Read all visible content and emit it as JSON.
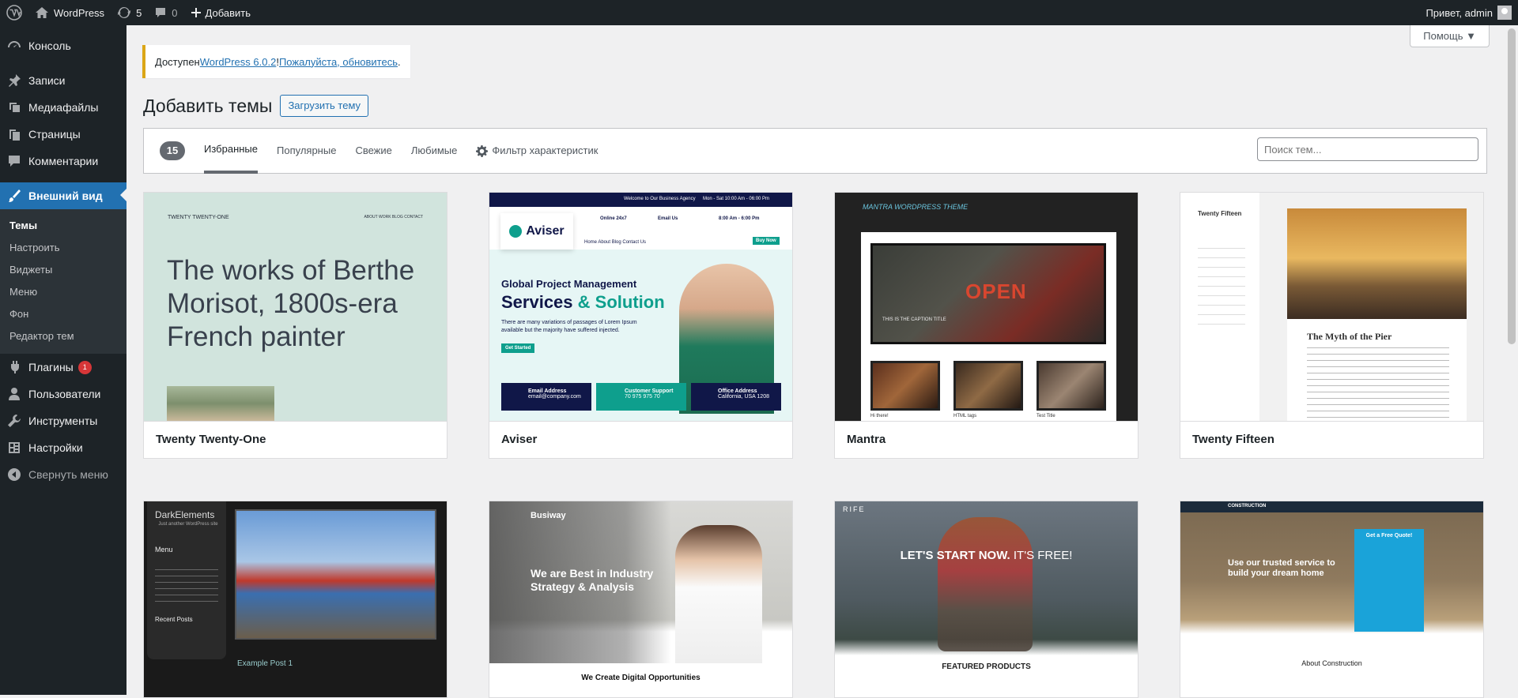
{
  "adminbar": {
    "site": "WordPress",
    "updates": "5",
    "comments": "0",
    "new": "Добавить",
    "greeting": "Привет, admin"
  },
  "sidebar": {
    "items": [
      {
        "label": "Консоль",
        "icon": "dashboard-icon"
      },
      {
        "label": "Записи",
        "icon": "pin-icon"
      },
      {
        "label": "Медиафайлы",
        "icon": "media-icon"
      },
      {
        "label": "Страницы",
        "icon": "page-icon"
      },
      {
        "label": "Комментарии",
        "icon": "comment-icon"
      },
      {
        "label": "Внешний вид",
        "icon": "brush-icon"
      },
      {
        "label": "Плагины",
        "icon": "plugin-icon",
        "badge": "1"
      },
      {
        "label": "Пользователи",
        "icon": "users-icon"
      },
      {
        "label": "Инструменты",
        "icon": "wrench-icon"
      },
      {
        "label": "Настройки",
        "icon": "settings-icon"
      },
      {
        "label": "Свернуть меню",
        "icon": "collapse-icon"
      }
    ],
    "submenu": [
      "Темы",
      "Настроить",
      "Виджеты",
      "Меню",
      "Фон",
      "Редактор тем"
    ]
  },
  "help": "Помощь",
  "notice": {
    "prefix": "Доступен ",
    "link1": "WordPress 6.0.2",
    "mid": "! ",
    "link2": "Пожалуйста, обновитесь",
    "suffix": "."
  },
  "title": "Добавить темы",
  "upload": "Загрузить тему",
  "filter": {
    "count": "15",
    "tabs": [
      "Избранные",
      "Популярные",
      "Свежие",
      "Любимые"
    ],
    "features": "Фильтр характеристик",
    "search_placeholder": "Поиск тем..."
  },
  "themes": [
    {
      "name": "Twenty Twenty-One",
      "site": "TWENTY TWENTY-ONE",
      "nav": "ABOUT  WORK  BLOG  CONTACT",
      "headline": "The works of Berthe Morisot, 1800s-era French painter"
    },
    {
      "name": "Aviser",
      "logo": "Aviser",
      "topbar": "Welcome to Our Business Agency",
      "hours": "Mon - Sat 10:00 Am - 06:00 Pm",
      "c1": "Online 24x7",
      "c2": "Email Us",
      "c3": "8:00 Am - 6:00 Pm",
      "nav": "Home   About   Blog   Contact Us",
      "buy": "Buy Now",
      "h1": "Global Project Management",
      "h2a": "Services",
      "h2b": "& Solution",
      "p": "There are many variations of passages of Lorem Ipsum available but the majority have suffered injected.",
      "cta": "Get Started",
      "b1": "Email Address",
      "b1s": "email@company.com",
      "b2": "Customer Support",
      "b2s": "70 975 975 70",
      "b3": "Office Address",
      "b3s": "California, USA 1208"
    },
    {
      "name": "Mantra",
      "logo": "MANTRA WORDPRESS THEME",
      "caption": "THIS IS THE CAPTION TITLE",
      "sign": "OPEN",
      "t1": "Hi there!",
      "t2": "HTML tags",
      "t3": "Test Title"
    },
    {
      "name": "Twenty Fifteen",
      "site": "Twenty Fifteen",
      "post": "The Myth of the Pier"
    },
    {
      "site": "DarkElements",
      "tag": "Just another WordPress site",
      "menu": "Menu",
      "recent": "Recent Posts",
      "post": "Example Post 1"
    },
    {
      "logo": "Busiway",
      "h1": "We are Best in Industry",
      "h2": "Strategy & Analysis",
      "bottom": "We Create Digital Opportunities"
    },
    {
      "logo": "RIFE",
      "h1": "LET'S START NOW.",
      "h2": "IT'S FREE!",
      "featured": "FEATURED PRODUCTS"
    },
    {
      "logo": "CONSTRUCTION",
      "h1": "Use our trusted service to build your dream home",
      "quote": "Get a Free Quote!",
      "about": "About Construction"
    }
  ]
}
